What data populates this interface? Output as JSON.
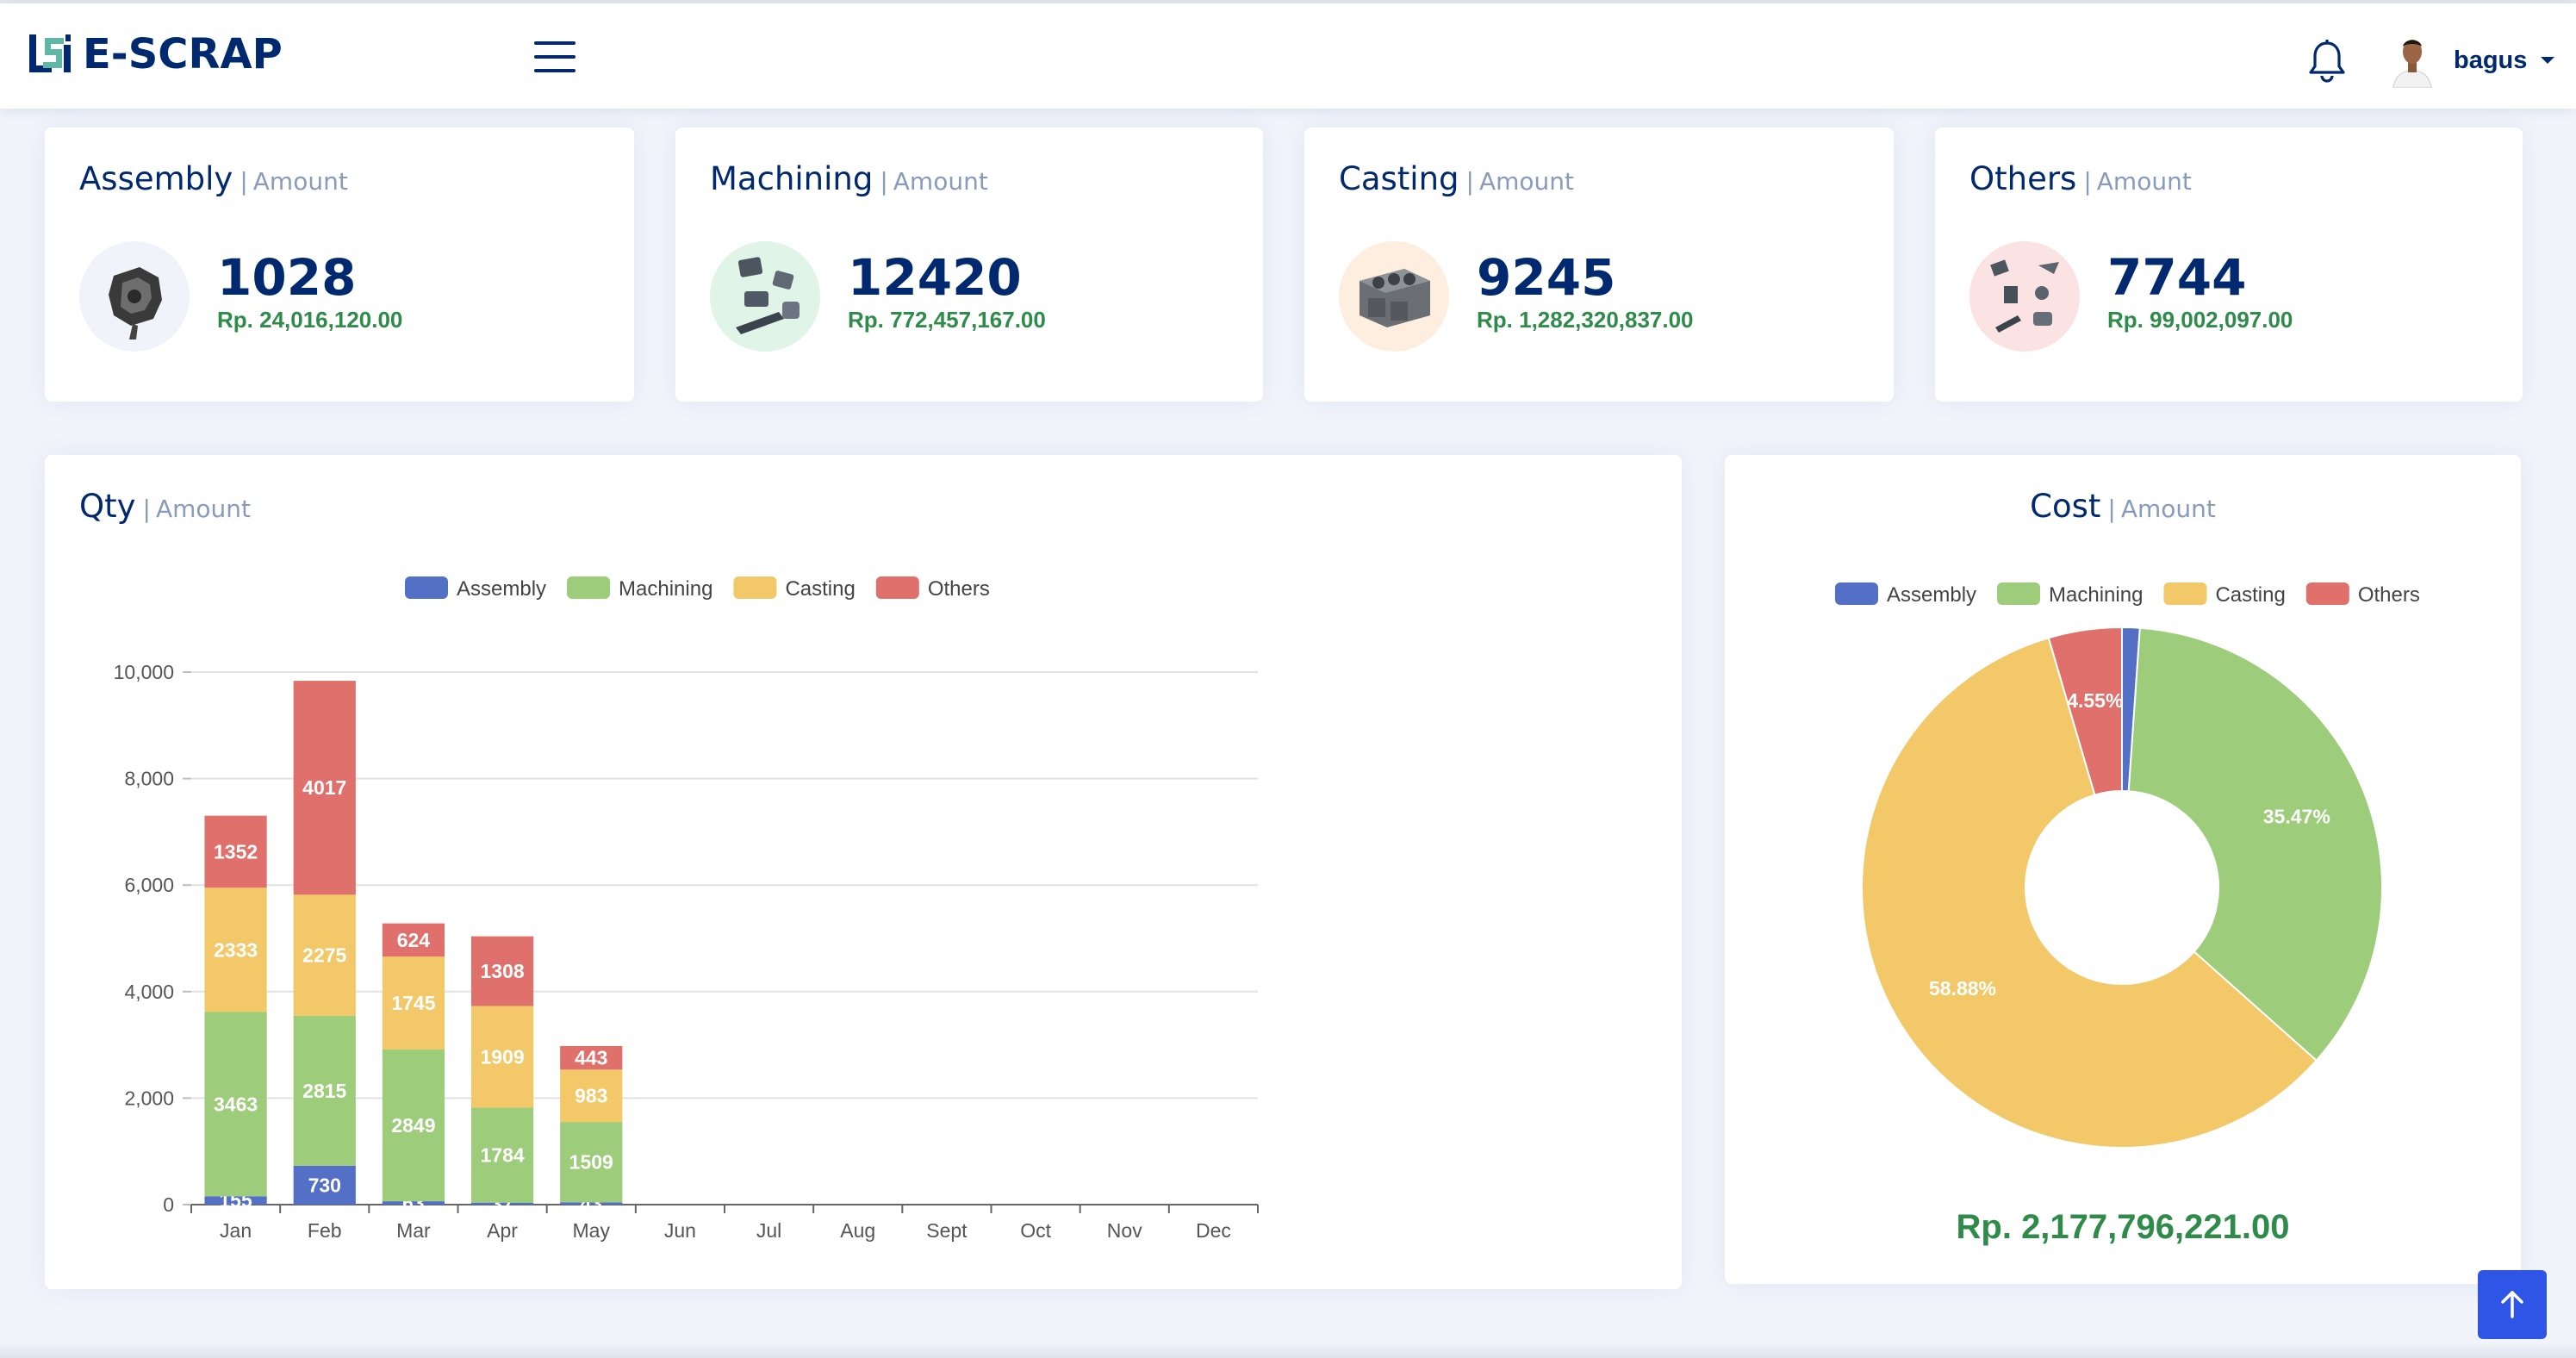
{
  "header": {
    "app_name": "E-SCRAP",
    "user_name": "bagus"
  },
  "stats": [
    {
      "title": "Assembly",
      "subtitle": "Amount",
      "value": "1028",
      "money": "Rp. 24,016,120.00"
    },
    {
      "title": "Machining",
      "subtitle": "Amount",
      "value": "12420",
      "money": "Rp. 772,457,167.00"
    },
    {
      "title": "Casting",
      "subtitle": "Amount",
      "value": "9245",
      "money": "Rp. 1,282,320,837.00"
    },
    {
      "title": "Others",
      "subtitle": "Amount",
      "value": "7744",
      "money": "Rp. 99,002,097.00"
    }
  ],
  "qty_panel": {
    "title": "Qty",
    "subtitle": "Amount"
  },
  "cost_panel": {
    "title": "Cost",
    "subtitle": "Amount",
    "total": "Rp. 2,177,796,221.00"
  },
  "colors": {
    "Assembly": "#5470c6",
    "Machining": "#9dcc7a",
    "Casting": "#f2c869",
    "Others": "#e0706b"
  },
  "chart_data": [
    {
      "type": "bar",
      "stacked": true,
      "categories": [
        "Jan",
        "Feb",
        "Mar",
        "Apr",
        "May",
        "Jun",
        "Jul",
        "Aug",
        "Sept",
        "Oct",
        "Nov",
        "Dec"
      ],
      "series": [
        {
          "name": "Assembly",
          "values": [
            155,
            730,
            63,
            37,
            43,
            null,
            null,
            null,
            null,
            null,
            null,
            null
          ]
        },
        {
          "name": "Machining",
          "values": [
            3463,
            2815,
            2849,
            1784,
            1509,
            null,
            null,
            null,
            null,
            null,
            null,
            null
          ]
        },
        {
          "name": "Casting",
          "values": [
            2333,
            2275,
            1745,
            1909,
            983,
            null,
            null,
            null,
            null,
            null,
            null,
            null
          ]
        },
        {
          "name": "Others",
          "values": [
            1352,
            4017,
            624,
            1308,
            443,
            null,
            null,
            null,
            null,
            null,
            null,
            null
          ]
        }
      ],
      "y_ticks": [
        "0",
        "2,000",
        "4,000",
        "6,000",
        "8,000",
        "10,000"
      ],
      "ylim": [
        0,
        10000
      ],
      "legend": "top-center",
      "grid": true
    },
    {
      "type": "pie",
      "donut": true,
      "labels": [
        "Assembly",
        "Machining",
        "Casting",
        "Others"
      ],
      "values": [
        1.1,
        35.47,
        58.88,
        4.55
      ],
      "value_labels": [
        "",
        "35.47%",
        "58.88%",
        "4.55%"
      ],
      "legend": "top-center"
    }
  ]
}
